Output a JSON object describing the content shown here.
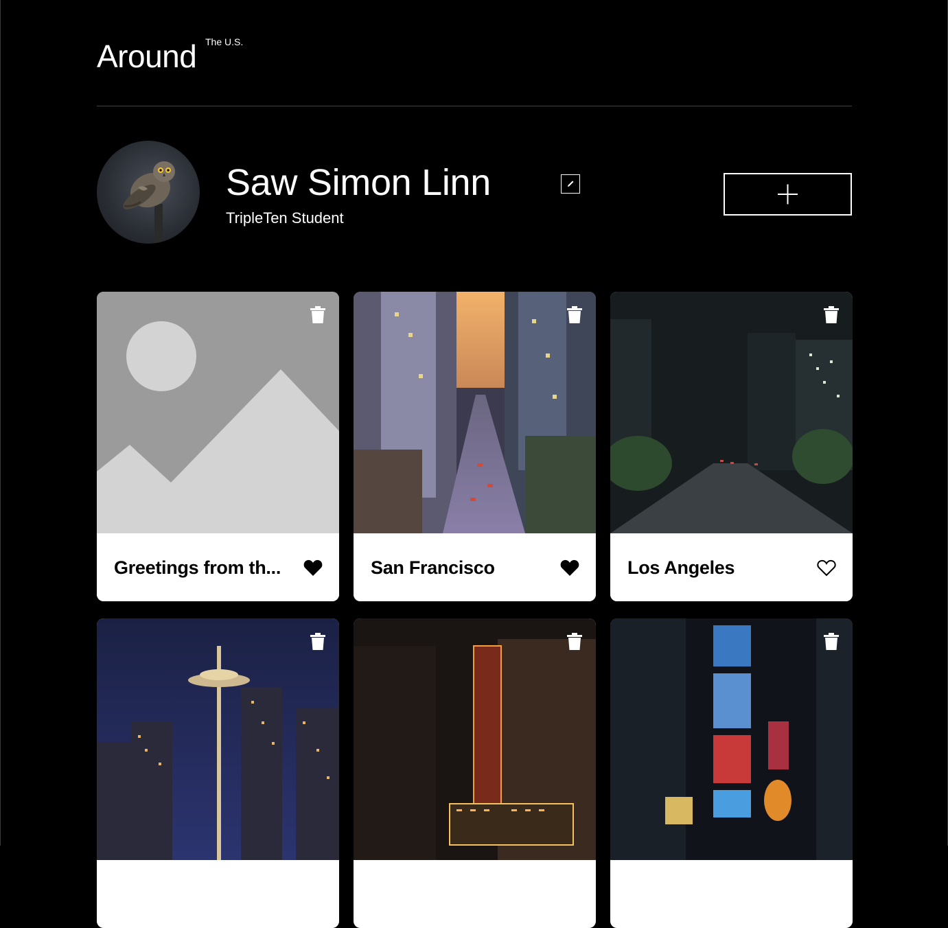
{
  "header": {
    "logo_main": "Around",
    "logo_sup": "The U.S."
  },
  "profile": {
    "name": "Saw Simon Linn",
    "job": "TripleTen Student"
  },
  "cards": [
    {
      "title": "Greetings from the U.S.",
      "display_title": "Greetings from th...",
      "liked": true,
      "image": "placeholder-image"
    },
    {
      "title": "San Francisco",
      "liked": true,
      "image": "san-francisco-street"
    },
    {
      "title": "Los Angeles",
      "liked": false,
      "image": "los-angeles-street"
    },
    {
      "title": "",
      "liked": false,
      "image": "seattle-space-needle"
    },
    {
      "title": "",
      "liked": false,
      "image": "chicago-theatre"
    },
    {
      "title": "",
      "liked": false,
      "image": "new-york-times-square"
    }
  ],
  "colors": {
    "background": "#000000",
    "card": "#ffffff",
    "text_primary": "#ffffff",
    "card_text": "#000000"
  }
}
